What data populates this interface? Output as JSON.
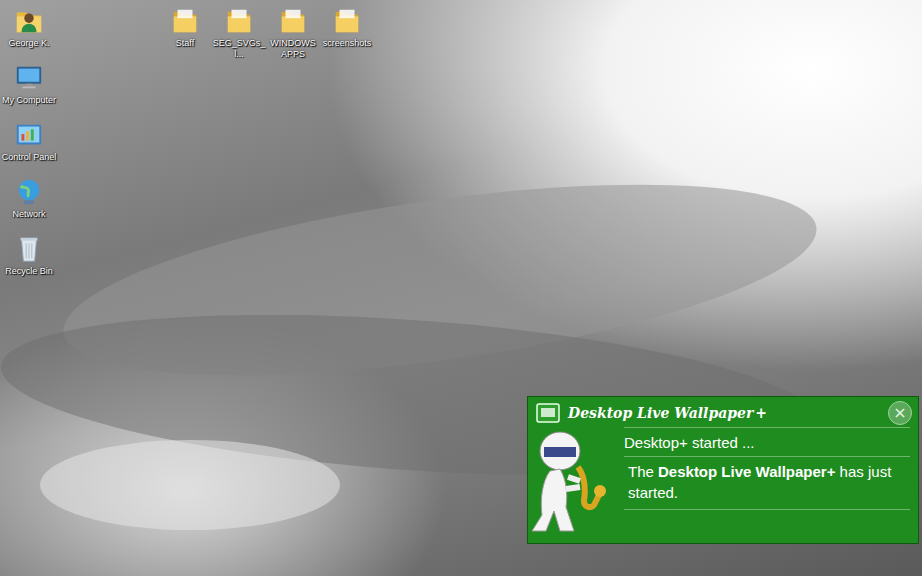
{
  "desktop_icons": [
    {
      "label": "George K.",
      "kind": "user"
    },
    {
      "label": "My Computer",
      "kind": "computer"
    },
    {
      "label": "Control Panel",
      "kind": "control-panel"
    },
    {
      "label": "Network",
      "kind": "network"
    },
    {
      "label": "Recycle Bin",
      "kind": "recycle-bin"
    }
  ],
  "folders": [
    {
      "label": "Staff"
    },
    {
      "label": "SEG_SVGs_l..."
    },
    {
      "label": "WINDOWS APPS"
    },
    {
      "label": "screenshots"
    }
  ],
  "notification": {
    "title": "Desktop Live Wallpaper",
    "title_suffix": "+",
    "close": "×",
    "heading": "Desktop+ started ...",
    "body": [
      {
        "text": "The ",
        "bold": false
      },
      {
        "text": "Desktop Live Wallpaper+",
        "bold": true
      },
      {
        "text": " has just started.",
        "bold": false
      }
    ]
  }
}
